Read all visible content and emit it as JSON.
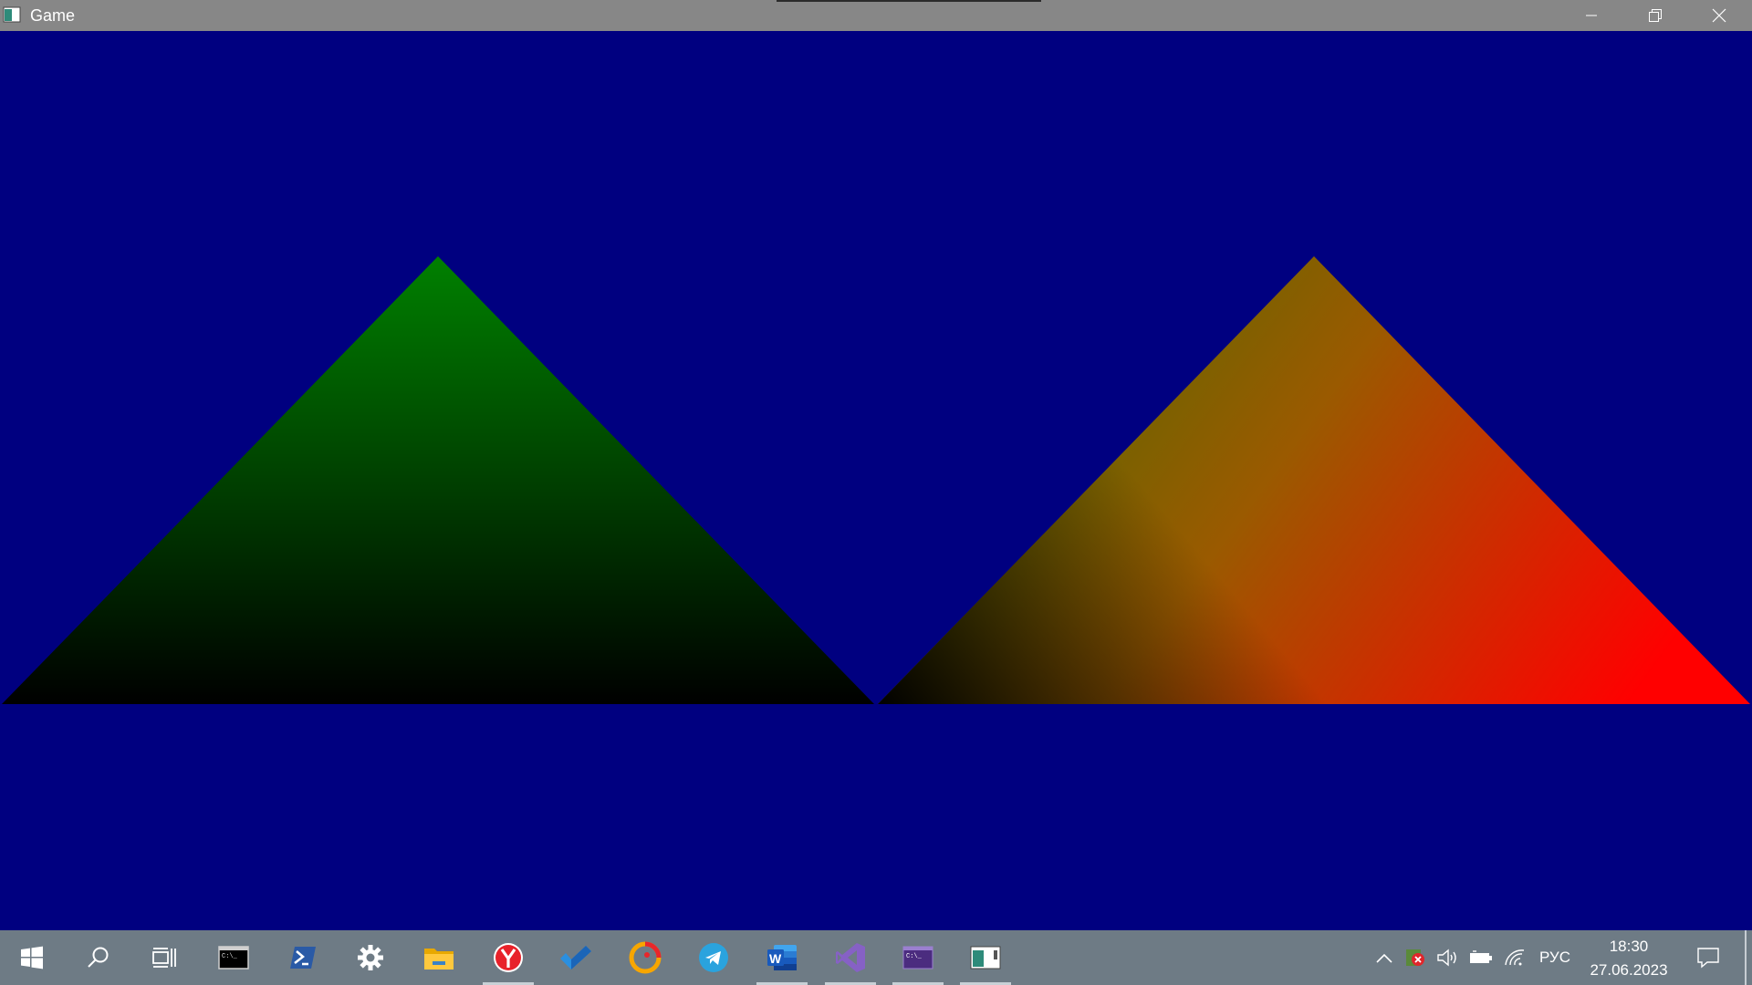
{
  "window": {
    "title": "Game",
    "controls": {
      "minimize": "minimize-icon",
      "maximize": "restore-icon",
      "close": "close-icon"
    }
  },
  "scene": {
    "background": "#000080",
    "triangles": [
      {
        "name": "left-triangle",
        "gradient": "vertical",
        "colors": [
          "#008000",
          "#000000"
        ]
      },
      {
        "name": "right-triangle",
        "gradient": "diagonal",
        "colors": [
          "#808000",
          "#000000",
          "#FF0000"
        ]
      }
    ]
  },
  "taskbar": {
    "background": "#6e7b85",
    "apps": [
      {
        "name": "start",
        "icon": "windows-logo-icon"
      },
      {
        "name": "search",
        "icon": "search-icon"
      },
      {
        "name": "task-view",
        "icon": "task-view-icon"
      },
      {
        "name": "command-prompt",
        "icon": "cmd-icon"
      },
      {
        "name": "powershell",
        "icon": "powershell-icon"
      },
      {
        "name": "settings",
        "icon": "gear-icon"
      },
      {
        "name": "file-explorer",
        "icon": "folder-icon"
      },
      {
        "name": "yandex-browser",
        "icon": "yandex-browser-icon"
      },
      {
        "name": "microsoft-todo",
        "icon": "checkmark-icon"
      },
      {
        "name": "alice",
        "icon": "alice-icon"
      },
      {
        "name": "telegram",
        "icon": "telegram-icon"
      },
      {
        "name": "word",
        "icon": "word-icon"
      },
      {
        "name": "visual-studio",
        "icon": "visual-studio-icon"
      },
      {
        "name": "vs-debug-console",
        "icon": "console-icon"
      },
      {
        "name": "game",
        "icon": "game-window-icon"
      }
    ],
    "tray": {
      "icons": [
        "chevron-up-icon",
        "antivirus-error-icon",
        "volume-icon",
        "battery-icon",
        "wifi-icon"
      ],
      "language": "РУС",
      "time": "18:30",
      "date": "27.06.2023",
      "notification": "notification-icon"
    }
  }
}
